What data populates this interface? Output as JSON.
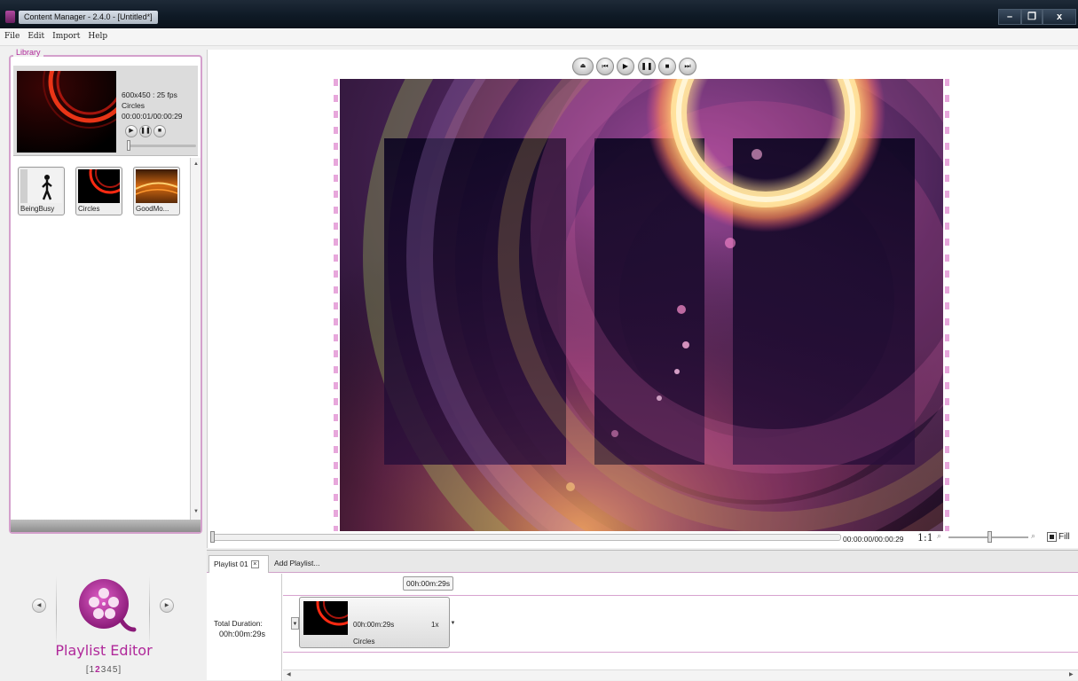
{
  "window": {
    "title": "Content Manager - 2.4.0 - [Untitled*]",
    "min": "–",
    "max": "❐",
    "close": "x"
  },
  "menu": [
    "File",
    "Edit",
    "Import",
    "Help"
  ],
  "library": {
    "label": "Library",
    "preview": {
      "resolution": "600x450 : 25 fps",
      "name": "Circles",
      "time": "00:00:01/00:00:29",
      "position": 0.0
    },
    "items": [
      {
        "label": "BeingBusy",
        "icon": "person-thumbnail"
      },
      {
        "label": "Circles",
        "icon": "circles-thumbnail"
      },
      {
        "label": "GoodMo...",
        "icon": "sunset-thumbnail"
      }
    ]
  },
  "player": {
    "controls": [
      "eject",
      "previous",
      "play",
      "pause",
      "stop",
      "next"
    ],
    "time": "00:00:00/00:00:29",
    "ratio": "1:1",
    "fill_label": "Fill",
    "scrub_position": 0.0,
    "zoom_position": 0.5
  },
  "playlist": {
    "tab_label": "Playlist 01",
    "add_tab_label": "Add Playlist...",
    "total_label": "Total Duration:",
    "total_value": "00h:00m:29s",
    "ruler_badge": "00h:00m:29s",
    "clip": {
      "duration": "00h:00m:29s",
      "repeat": "1x",
      "name": "Circles"
    }
  },
  "editor_nav": {
    "label": "Playlist Editor",
    "pages_open": "[",
    "pages_before": "1",
    "pages_current": "2",
    "pages_after": "345",
    "pages_close": "]"
  },
  "colors": {
    "accent": "#b0289a",
    "border": "#d4a0cc",
    "titlebar": "#0f1a26"
  }
}
